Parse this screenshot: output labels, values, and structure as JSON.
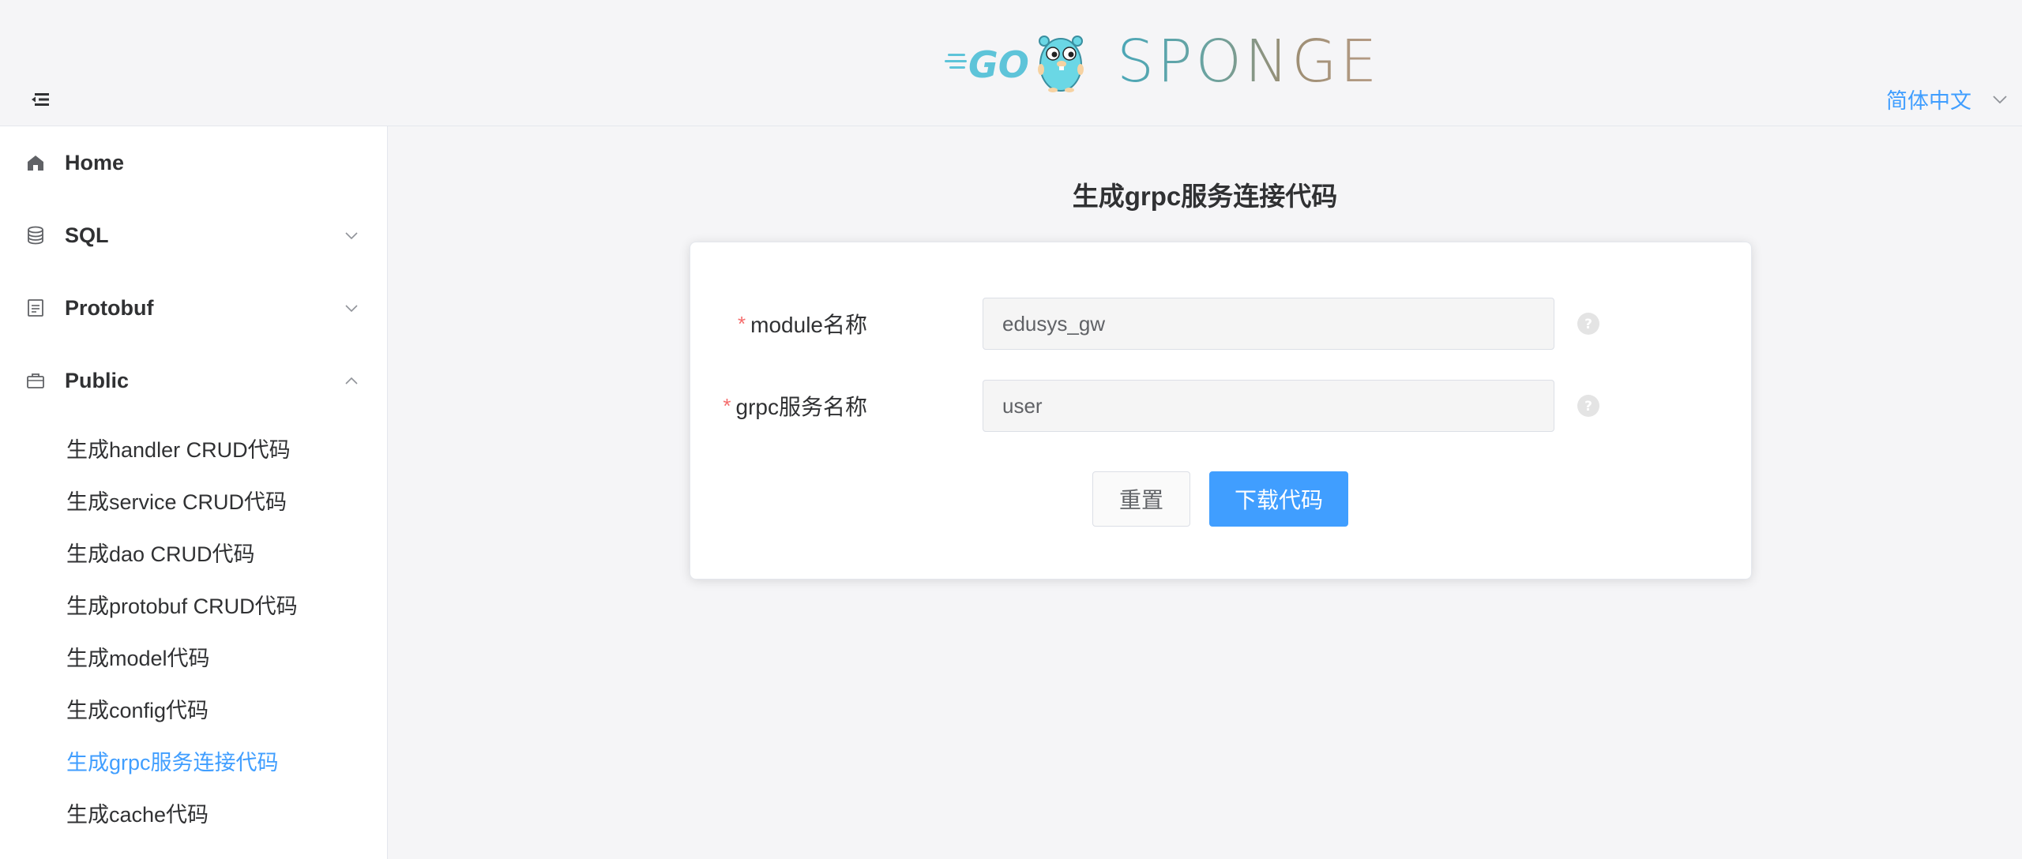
{
  "header": {
    "logo_go_text": "GO",
    "logo_sponge_text": "SPONGE",
    "language": "简体中文"
  },
  "sidebar": {
    "items": [
      {
        "label": "Home",
        "icon": "home-icon"
      },
      {
        "label": "SQL",
        "icon": "database-icon",
        "expanded": false
      },
      {
        "label": "Protobuf",
        "icon": "document-icon",
        "expanded": false
      },
      {
        "label": "Public",
        "icon": "briefcase-icon",
        "expanded": true
      }
    ],
    "public_children": [
      {
        "label": "生成handler CRUD代码",
        "active": false
      },
      {
        "label": "生成service CRUD代码",
        "active": false
      },
      {
        "label": "生成dao CRUD代码",
        "active": false
      },
      {
        "label": "生成protobuf CRUD代码",
        "active": false
      },
      {
        "label": "生成model代码",
        "active": false
      },
      {
        "label": "生成config代码",
        "active": false
      },
      {
        "label": "生成grpc服务连接代码",
        "active": true
      },
      {
        "label": "生成cache代码",
        "active": false
      }
    ]
  },
  "main": {
    "title": "生成grpc服务连接代码",
    "form": {
      "module_label": "module名称",
      "module_value": "edusys_gw",
      "service_label": "grpc服务名称",
      "service_value": "user",
      "required_mark": "*"
    },
    "buttons": {
      "reset": "重置",
      "download": "下载代码"
    }
  },
  "colors": {
    "accent": "#409eff",
    "required": "#f56c6c",
    "text": "#303133",
    "background": "#f5f5f7"
  }
}
